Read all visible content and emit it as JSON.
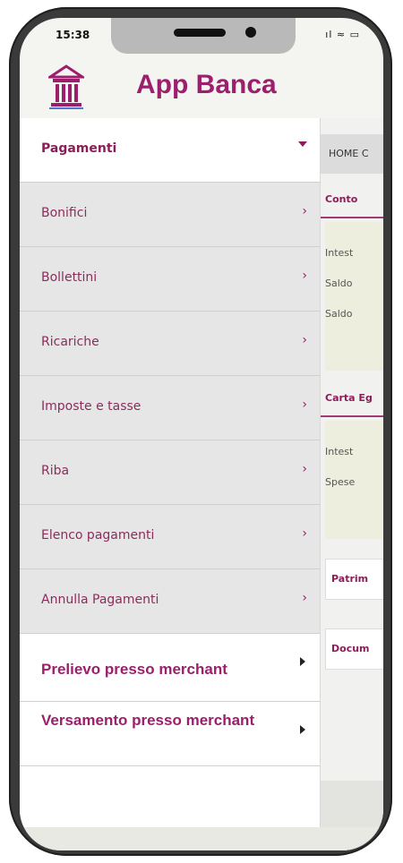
{
  "status_bar": {
    "time": "15:38",
    "icons": "ıl ≈ ▭"
  },
  "header": {
    "title": "App Banca",
    "logo_icon": "bank-building-icon"
  },
  "menu": {
    "section_label": "Pagamenti",
    "items": [
      {
        "label": "Bonifici"
      },
      {
        "label": "Bollettini"
      },
      {
        "label": "Ricariche"
      },
      {
        "label": "Imposte e tasse"
      },
      {
        "label": "Riba"
      },
      {
        "label": "Elenco pagamenti"
      },
      {
        "label": "Annulla Pagamenti"
      }
    ],
    "extra_items": [
      {
        "label": "Prelievo presso merchant"
      },
      {
        "label": "Versamento presso merchant"
      }
    ],
    "chevron": "›"
  },
  "content": {
    "breadcrumb": "HOME C",
    "conto": {
      "title": "Conto",
      "rows": [
        "Intest",
        "Saldo",
        "Saldo"
      ]
    },
    "carta": {
      "title": "Carta Eg",
      "rows": [
        "Intest",
        "Spese"
      ]
    },
    "cards": [
      "Patrim",
      "Docum"
    ]
  },
  "colors": {
    "accent": "#9b1f6c",
    "menu_gray": "#e6e6e6"
  }
}
